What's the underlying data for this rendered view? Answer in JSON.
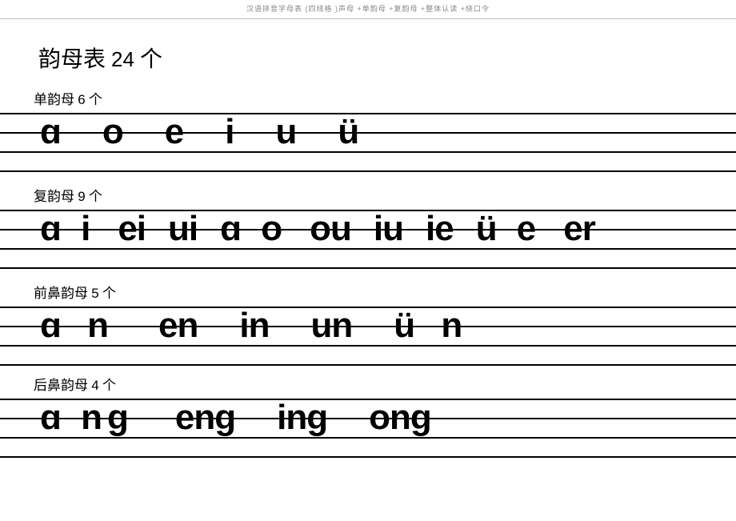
{
  "header": "汉语拼音字母表  (四线格 )声母 +单韵母 +复韵母 +整体认读 +绕口令",
  "mainTitle": {
    "text": "韵母表",
    "count": "24",
    "unit": "个"
  },
  "sections": [
    {
      "title": "单韵母",
      "count": "6",
      "unit": "个",
      "items": [
        "ɑ",
        "o",
        "e",
        "i",
        "u",
        "ü"
      ],
      "narrow": false
    },
    {
      "title": "复韵母",
      "count": "9",
      "unit": "个",
      "items": [
        "ɑ i",
        "ei",
        "ui",
        "ɑ o",
        "ou",
        "iu",
        "ie",
        "ü e",
        "er"
      ],
      "narrow": true
    },
    {
      "title": "前鼻韵母",
      "count": "5",
      "unit": "个",
      "items": [
        "ɑ n",
        "en",
        "in",
        "un",
        "ü n"
      ],
      "narrow": false
    },
    {
      "title": "后鼻韵母",
      "count": "4",
      "unit": "个",
      "items": [
        "ɑ nɡ",
        "enɡ",
        "inɡ",
        "onɡ"
      ],
      "narrow": false
    }
  ]
}
